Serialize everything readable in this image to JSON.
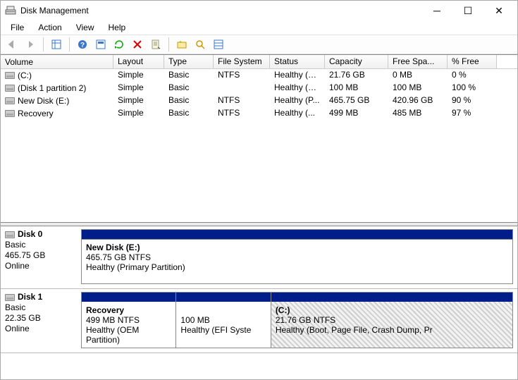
{
  "window": {
    "title": "Disk Management"
  },
  "menu": {
    "file": "File",
    "action": "Action",
    "view": "View",
    "help": "Help"
  },
  "columns": {
    "volume": "Volume",
    "layout": "Layout",
    "type": "Type",
    "fs": "File System",
    "status": "Status",
    "capacity": "Capacity",
    "free": "Free Spa...",
    "pct": "% Free"
  },
  "volumes": [
    {
      "name": "(C:)",
      "layout": "Simple",
      "type": "Basic",
      "fs": "NTFS",
      "status": "Healthy (B...",
      "capacity": "21.76 GB",
      "free": "0 MB",
      "pct": "0 %"
    },
    {
      "name": "(Disk 1 partition 2)",
      "layout": "Simple",
      "type": "Basic",
      "fs": "",
      "status": "Healthy (E...",
      "capacity": "100 MB",
      "free": "100 MB",
      "pct": "100 %"
    },
    {
      "name": "New Disk (E:)",
      "layout": "Simple",
      "type": "Basic",
      "fs": "NTFS",
      "status": "Healthy (P...",
      "capacity": "465.75 GB",
      "free": "420.96 GB",
      "pct": "90 %"
    },
    {
      "name": "Recovery",
      "layout": "Simple",
      "type": "Basic",
      "fs": "NTFS",
      "status": "Healthy (...",
      "capacity": "499 MB",
      "free": "485 MB",
      "pct": "97 %"
    }
  ],
  "disks": [
    {
      "name": "Disk 0",
      "type": "Basic",
      "size": "465.75 GB",
      "state": "Online",
      "multi": false,
      "parts": [
        {
          "title": "New Disk  (E:)",
          "sub": "465.75 GB NTFS",
          "status": "Healthy (Primary Partition)",
          "w": "100%",
          "hatched": false
        }
      ]
    },
    {
      "name": "Disk 1",
      "type": "Basic",
      "size": "22.35 GB",
      "state": "Online",
      "multi": true,
      "parts": [
        {
          "title": "Recovery",
          "sub": "499 MB NTFS",
          "status": "Healthy (OEM Partition)",
          "w": "22%",
          "hatched": false
        },
        {
          "title": "",
          "sub": "100 MB",
          "status": "Healthy (EFI Syste",
          "w": "22%",
          "hatched": false
        },
        {
          "title": "(C:)",
          "sub": "21.76 GB NTFS",
          "status": "Healthy (Boot, Page File, Crash Dump, Pr",
          "w": "56%",
          "hatched": true
        }
      ]
    }
  ]
}
